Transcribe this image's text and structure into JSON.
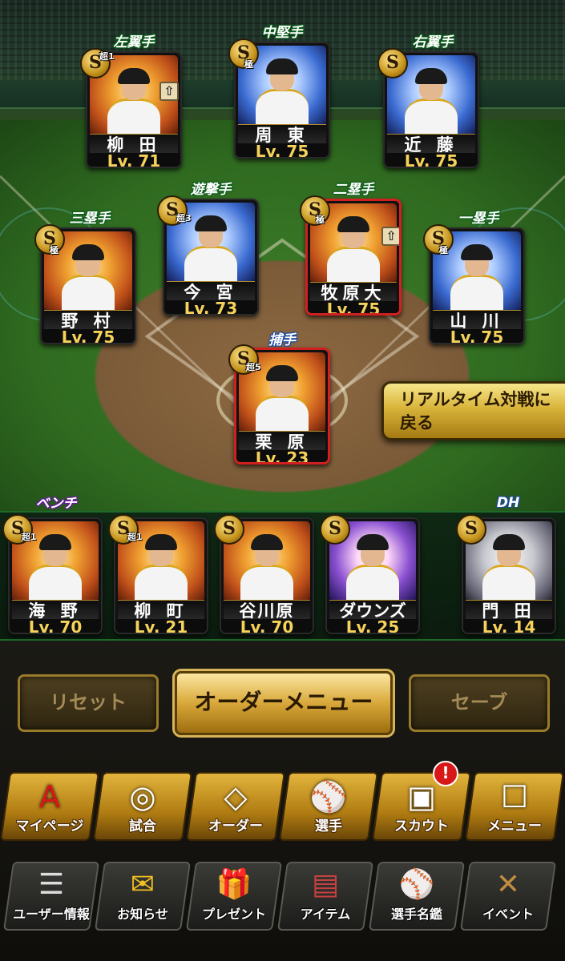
{
  "positions": {
    "left_field": "左翼手",
    "center_field": "中堅手",
    "right_field": "右翼手",
    "third_base": "三塁手",
    "shortstop": "遊撃手",
    "second_base": "二塁手",
    "first_base": "一塁手",
    "catcher": "捕手",
    "bench": "ベンチ",
    "dh": "DH"
  },
  "lineup": {
    "left_field": {
      "name": "柳 田",
      "level": "Lv. 71",
      "rank": "S",
      "rank_note": "超1"
    },
    "center_field": {
      "name": "周 東",
      "level": "Lv. 75",
      "rank": "S",
      "rank_note": "極"
    },
    "right_field": {
      "name": "近 藤",
      "level": "Lv. 75",
      "rank": "S",
      "rank_note": ""
    },
    "third_base": {
      "name": "野 村",
      "level": "Lv. 75",
      "rank": "S",
      "rank_note": "極"
    },
    "shortstop": {
      "name": "今 宮",
      "level": "Lv. 73",
      "rank": "S",
      "rank_note": "超3"
    },
    "second_base": {
      "name": "牧原大",
      "level": "Lv. 75",
      "rank": "S",
      "rank_note": "極"
    },
    "first_base": {
      "name": "山 川",
      "level": "Lv. 75",
      "rank": "S",
      "rank_note": "極"
    },
    "catcher": {
      "name": "栗 原",
      "level": "Lv. 23",
      "rank": "S",
      "rank_note": "超5"
    }
  },
  "bench": [
    {
      "name": "海 野",
      "level": "Lv. 70",
      "rank": "S",
      "rank_note": "超1"
    },
    {
      "name": "柳 町",
      "level": "Lv. 21",
      "rank": "S",
      "rank_note": "超1"
    },
    {
      "name": "谷川原",
      "level": "Lv. 70",
      "rank": "S",
      "rank_note": ""
    },
    {
      "name": "ダウンズ",
      "level": "Lv. 25",
      "rank": "S",
      "rank_note": ""
    }
  ],
  "dh_player": {
    "name": "門 田",
    "level": "Lv. 14",
    "rank": "S",
    "rank_note": ""
  },
  "realtime_button": {
    "line1": "リアルタイム対戦に",
    "line2": "戻る"
  },
  "actions": {
    "reset": "リセット",
    "order_menu": "オーダーメニュー",
    "save": "セーブ"
  },
  "main_nav": [
    {
      "label": "マイページ",
      "icon": "mypage-icon",
      "glyph": "A"
    },
    {
      "label": "試合",
      "icon": "stadium-icon",
      "glyph": "◎"
    },
    {
      "label": "オーダー",
      "icon": "order-icon",
      "glyph": "◇"
    },
    {
      "label": "選手",
      "icon": "player-icon",
      "glyph": "⚾"
    },
    {
      "label": "スカウト",
      "icon": "scout-icon",
      "glyph": "▣"
    },
    {
      "label": "メニュー",
      "icon": "menu-icon",
      "glyph": "☐"
    }
  ],
  "scout_alert": "!",
  "sub_nav": [
    {
      "label": "ユーザー情報",
      "icon": "user-info-icon",
      "glyph": "☰"
    },
    {
      "label": "お知らせ",
      "icon": "notice-icon",
      "glyph": "✉"
    },
    {
      "label": "プレゼント",
      "icon": "present-icon",
      "glyph": "🎁"
    },
    {
      "label": "アイテム",
      "icon": "item-icon",
      "glyph": "▤"
    },
    {
      "label": "選手名鑑",
      "icon": "directory-icon",
      "glyph": "⚾"
    },
    {
      "label": "イベント",
      "icon": "event-icon",
      "glyph": "✕"
    }
  ],
  "colors": {
    "level_text": "#f5d25a",
    "gold": "#d8a83a",
    "alert": "#d81818"
  }
}
